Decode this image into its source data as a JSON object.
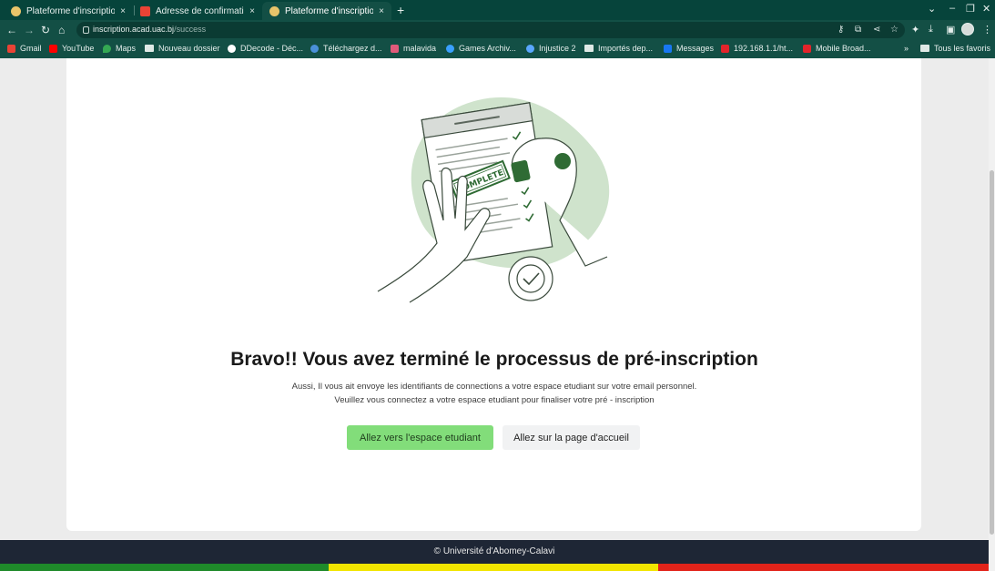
{
  "browser": {
    "tabs": [
      {
        "title": "Plateforme d'inscription",
        "favicon_color": "#e9c46a",
        "active": false
      },
      {
        "title": "Adresse de confirmation",
        "favicon_color": "#ea4335",
        "active": false
      },
      {
        "title": "Plateforme d'inscription",
        "favicon_color": "#e9c46a",
        "active": true
      }
    ],
    "close_glyph": "×",
    "new_tab_glyph": "+",
    "url_host": "inscription.acad.uac.bj",
    "url_path": "/success",
    "bookmarks": [
      {
        "label": "Gmail",
        "icon": "gmail-icon",
        "color": "#ea4335"
      },
      {
        "label": "YouTube",
        "icon": "youtube-icon",
        "color": "#ff0000"
      },
      {
        "label": "Maps",
        "icon": "maps-icon",
        "color": "#34a853"
      },
      {
        "label": "Nouveau dossier",
        "icon": "folder-icon",
        "color": "#dfe9e6"
      },
      {
        "label": "DDecode - Déc...",
        "icon": "globe-icon",
        "color": "#ffffff"
      },
      {
        "label": "Téléchargez d...",
        "icon": "download-site-icon",
        "color": "#4a90d9"
      },
      {
        "label": "malavida",
        "icon": "malavida-icon",
        "color": "#e05a7a"
      },
      {
        "label": "Games Archiv...",
        "icon": "games-icon",
        "color": "#3aa0ff"
      },
      {
        "label": "Injustice 2",
        "icon": "injustice-icon",
        "color": "#5aa7ff"
      },
      {
        "label": "Importés dep...",
        "icon": "folder-icon",
        "color": "#dfe9e6"
      },
      {
        "label": "Messages",
        "icon": "messenger-icon",
        "color": "#1877f2"
      },
      {
        "label": "192.168.1.1/ht...",
        "icon": "huawei-icon",
        "color": "#e3242b"
      },
      {
        "label": "Mobile Broad...",
        "icon": "huawei-icon",
        "color": "#e3242b"
      }
    ],
    "bookmarks_overflow": "»",
    "all_bookmarks": "Tous les favoris"
  },
  "illustration": {
    "stamp_text": "COMPLETE",
    "blob_color": "#cfe3cc",
    "stamp_color": "#2f6b34"
  },
  "content": {
    "title": "Bravo!! Vous avez terminé le processus de pré-inscription",
    "line1": "Aussi, Il vous ait envoye les identifiants de connections a votre espace etudiant sur votre email personnel.",
    "line2": "Veuillez vous connectez a votre espace etudiant pour finaliser votre pré - inscription",
    "primary_button": "Allez vers l'espace etudiant",
    "secondary_button": "Allez sur la page d'accueil"
  },
  "footer": {
    "text": "© Université d'Abomey-Calavi",
    "flag_colors": [
      "#1f8a2a",
      "#f2e500",
      "#e2231a"
    ]
  }
}
